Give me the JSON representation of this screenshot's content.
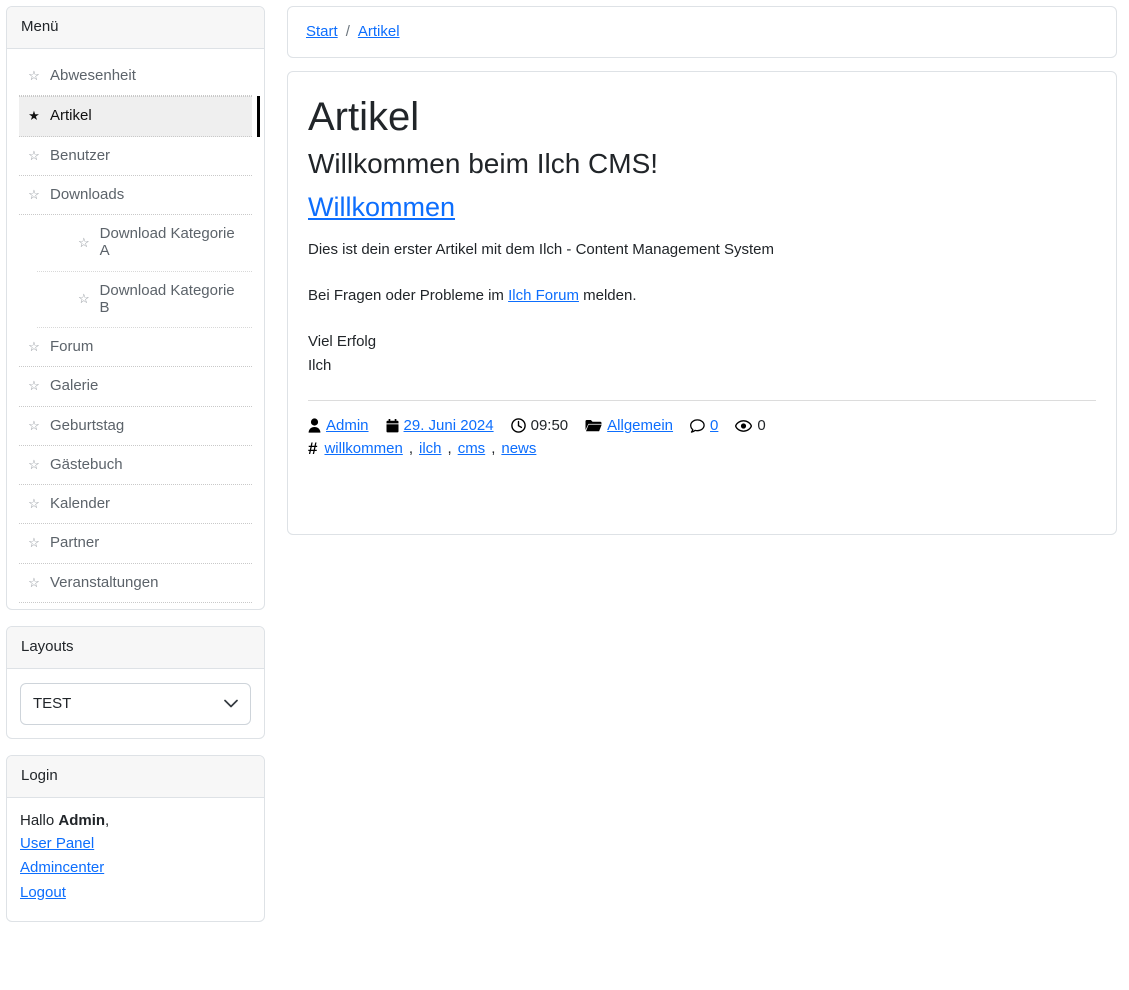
{
  "sidebar": {
    "menu_panel": {
      "title": "Menü",
      "items": [
        {
          "label": "Abwesenheit",
          "icon": "star-outline-icon",
          "active": false,
          "sub": false
        },
        {
          "label": "Artikel",
          "icon": "star-filled-icon",
          "active": true,
          "sub": false
        },
        {
          "label": "Benutzer",
          "icon": "star-outline-icon",
          "active": false,
          "sub": false
        },
        {
          "label": "Downloads",
          "icon": "star-outline-icon",
          "active": false,
          "sub": false
        },
        {
          "label": "Download Kategorie A",
          "icon": "star-outline-icon",
          "active": false,
          "sub": true
        },
        {
          "label": "Download Kategorie B",
          "icon": "star-outline-icon",
          "active": false,
          "sub": true
        },
        {
          "label": "Forum",
          "icon": "star-outline-icon",
          "active": false,
          "sub": false
        },
        {
          "label": "Galerie",
          "icon": "star-outline-icon",
          "active": false,
          "sub": false
        },
        {
          "label": "Geburtstag",
          "icon": "star-outline-icon",
          "active": false,
          "sub": false
        },
        {
          "label": "Gästebuch",
          "icon": "star-outline-icon",
          "active": false,
          "sub": false
        },
        {
          "label": "Kalender",
          "icon": "star-outline-icon",
          "active": false,
          "sub": false
        },
        {
          "label": "Partner",
          "icon": "star-outline-icon",
          "active": false,
          "sub": false
        },
        {
          "label": "Veranstaltungen",
          "icon": "star-outline-icon",
          "active": false,
          "sub": false
        }
      ]
    },
    "layouts_panel": {
      "title": "Layouts",
      "select": {
        "selected": "TEST",
        "options": [
          "TEST"
        ],
        "chevron_icon": "chevron-down-icon"
      }
    },
    "login_panel": {
      "title": "Login",
      "greeting_prefix": "Hallo ",
      "username": "Admin",
      "greeting_suffix": ",",
      "links": [
        {
          "label": "User Panel"
        },
        {
          "label": "Admincenter"
        },
        {
          "label": "Logout"
        }
      ]
    }
  },
  "breadcrumb": {
    "items": [
      {
        "label": "Start"
      },
      {
        "label": "Artikel"
      }
    ],
    "separator": "/"
  },
  "article": {
    "title": "Artikel",
    "subtitle": "Willkommen beim Ilch CMS!",
    "headline_link": "Willkommen",
    "paragraph_1": "Dies ist dein erster Artikel mit dem Ilch - Content Management System",
    "paragraph_2_before": "Bei Fragen oder Probleme im ",
    "paragraph_2_link": "Ilch Forum",
    "paragraph_2_after": " melden.",
    "signature_line_1": "Viel Erfolg",
    "signature_line_2": "Ilch",
    "meta": {
      "author": {
        "icon": "user-icon",
        "value": "Admin",
        "link": true
      },
      "date": {
        "icon": "calendar-icon",
        "value": "29. Juni 2024",
        "link": true
      },
      "time": {
        "icon": "clock-icon",
        "value": "09:50",
        "link": false
      },
      "category": {
        "icon": "folder-open-icon",
        "value": "Allgemein",
        "link": true
      },
      "comments": {
        "icon": "comment-icon",
        "value": "0",
        "link": true
      },
      "views": {
        "icon": "eye-icon",
        "value": "0",
        "link": false
      }
    },
    "tags": {
      "icon": "hash-icon",
      "items": [
        "willkommen",
        "ilch",
        "cms",
        "news"
      ],
      "separator": ", "
    }
  },
  "colors": {
    "link": "#0d6efd",
    "border": "#dee2e6",
    "header_bg": "#f7f7f7",
    "active_bg": "#efefef",
    "active_marker": "#000000",
    "muted_text": "#5c636a"
  }
}
